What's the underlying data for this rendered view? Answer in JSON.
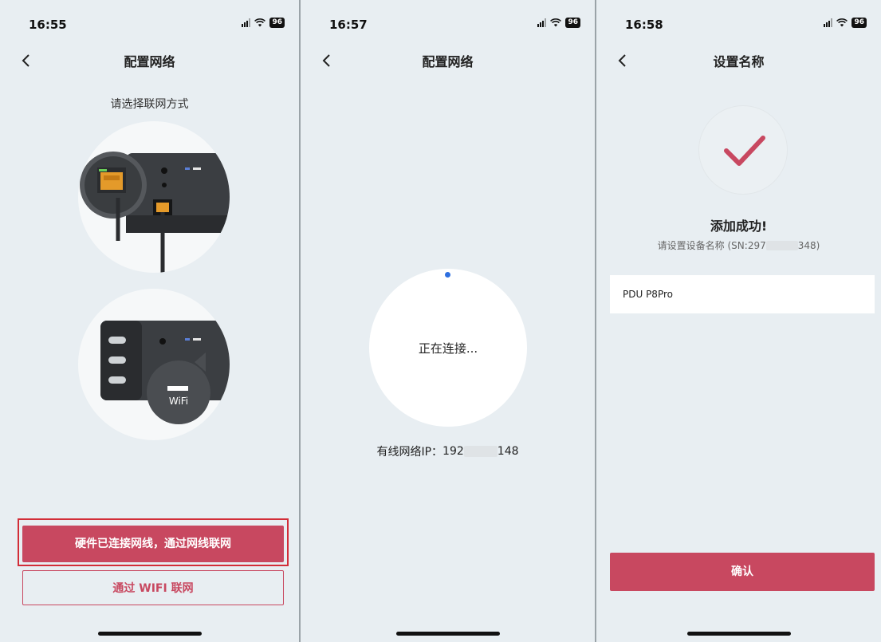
{
  "colors": {
    "accent": "#c84860",
    "background": "#e8eef2",
    "highlight": "#d22d38",
    "spinner_dot": "#2d6fe0"
  },
  "screen1": {
    "time": "16:55",
    "battery": "96",
    "title": "配置网络",
    "subtitle": "请选择联网方式",
    "illustrations": {
      "wifi_label": "WiFi"
    },
    "ethernet_button": "硬件已连接网线，通过网线联网",
    "wifi_button": "通过 WIFI 联网"
  },
  "screen2": {
    "time": "16:57",
    "battery": "96",
    "title": "配置网络",
    "connecting_text": "正在连接...",
    "ip_label": "有线网络IP：",
    "ip_prefix": "192",
    "ip_suffix": "148"
  },
  "screen3": {
    "time": "16:58",
    "battery": "96",
    "title": "设置名称",
    "success_title": "添加成功!",
    "sn_prompt": "请设置设备名称 (SN: ",
    "sn_prefix": "297",
    "sn_suffix": "348)",
    "device_name_value": "PDU P8Pro",
    "confirm_button": "确认"
  }
}
